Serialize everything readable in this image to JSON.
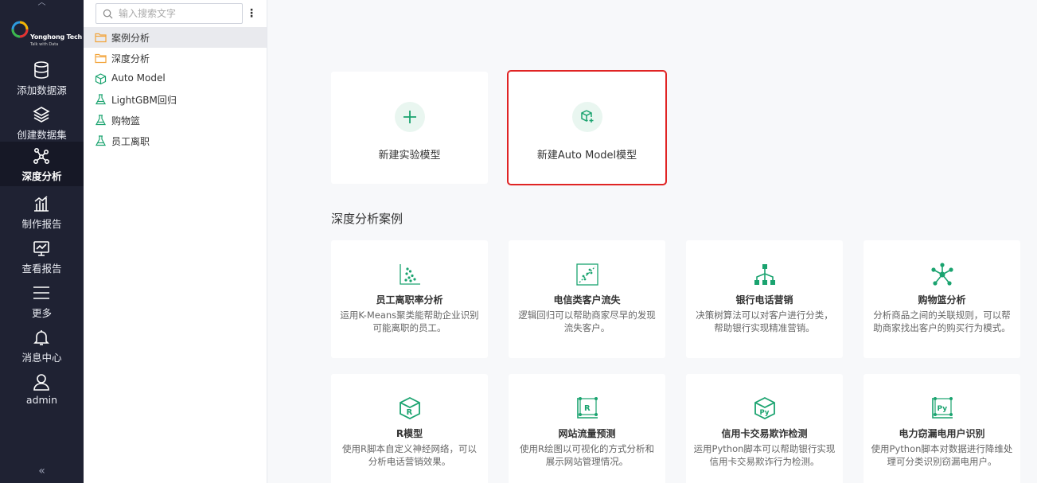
{
  "colors": {
    "accent": "#1aa36f",
    "nav_bg": "#1f2233",
    "highlight": "#e02424"
  },
  "logo": {
    "brand": "Yonghong Tech",
    "tagline": "Talk with Data"
  },
  "nav": [
    {
      "label": "添加数据源",
      "icon": "database-icon"
    },
    {
      "label": "创建数据集",
      "icon": "layers-icon"
    },
    {
      "label": "深度分析",
      "icon": "network-icon",
      "active": true
    },
    {
      "label": "制作报告",
      "icon": "bar-chart-icon"
    },
    {
      "label": "查看报告",
      "icon": "monitor-chart-icon"
    },
    {
      "label": "更多",
      "icon": "menu-icon"
    },
    {
      "label": "消息中心",
      "icon": "bell-icon"
    },
    {
      "label": "admin",
      "icon": "user-icon"
    }
  ],
  "tree": {
    "search_placeholder": "输入搜索文字",
    "items": [
      {
        "label": "案例分析",
        "icon": "folder-icon"
      },
      {
        "label": "深度分析",
        "icon": "folder-icon"
      },
      {
        "label": "Auto Model",
        "icon": "cube-icon"
      },
      {
        "label": "LightGBM回归",
        "icon": "flask-icon"
      },
      {
        "label": "购物篮",
        "icon": "flask-icon"
      },
      {
        "label": "员工离职",
        "icon": "flask-icon"
      }
    ]
  },
  "new_cards": [
    {
      "label": "新建实验模型",
      "icon": "plus-icon"
    },
    {
      "label": "新建Auto Model模型",
      "icon": "cube-plus-icon"
    }
  ],
  "section_title": "深度分析案例",
  "cases": [
    {
      "name": "员工离职率分析",
      "desc": "运用K-Means聚类能帮助企业识别可能离职的员工。",
      "icon": "scatter-icon"
    },
    {
      "name": "电信类客户流失",
      "desc": "逻辑回归可以帮助商家尽早的发现流失客户。",
      "icon": "regression-icon"
    },
    {
      "name": "银行电话营销",
      "desc": "决策树算法可以对客户进行分类，帮助银行实现精准营销。",
      "icon": "tree-icon"
    },
    {
      "name": "购物篮分析",
      "desc": "分析商品之间的关联规则，可以帮助商家找出客户的购买行为模式。",
      "icon": "star-network-icon"
    },
    {
      "name": "R模型",
      "desc": "使用R脚本自定义神经网络，可以分析电话营销效果。",
      "icon": "r-cube-icon"
    },
    {
      "name": "网站流量预测",
      "desc": "使用R绘图以可视化的方式分析和展示网站管理情况。",
      "icon": "r-chart-icon"
    },
    {
      "name": "信用卡交易欺诈检测",
      "desc": "运用Python脚本可以帮助银行实现信用卡交易欺诈行为检测。",
      "icon": "py-cube-icon"
    },
    {
      "name": "电力窃漏电用户识别",
      "desc": "使用Python脚本对数据进行降维处理可分类识别窃漏电用户。",
      "icon": "py-chart-icon"
    }
  ]
}
